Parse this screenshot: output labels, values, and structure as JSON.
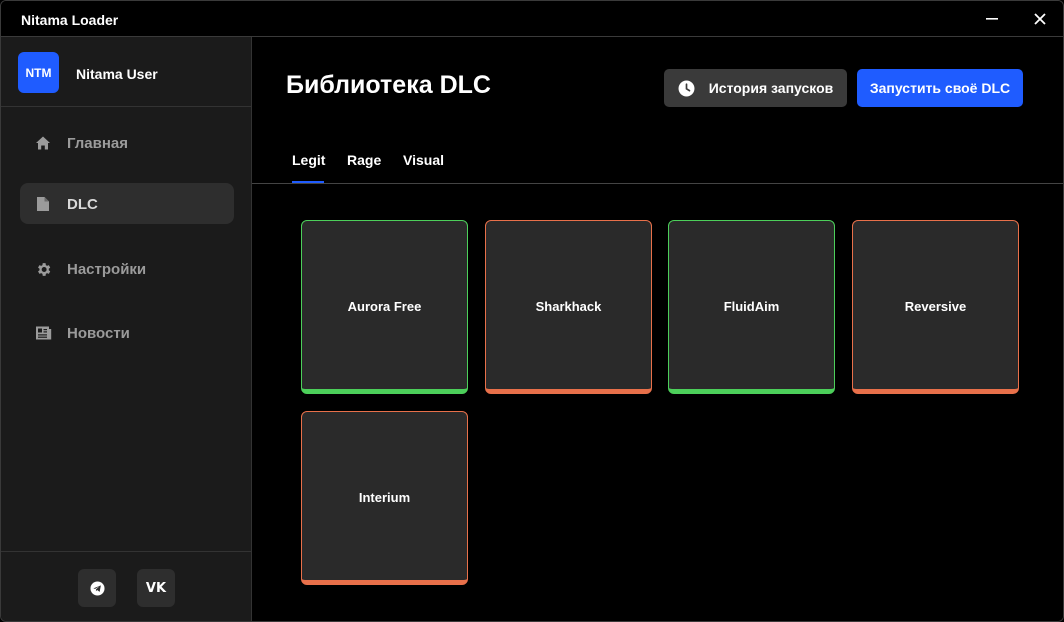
{
  "window": {
    "title": "Nitama Loader"
  },
  "profile": {
    "avatar_text": "NTM",
    "username": "Nitama User"
  },
  "sidebar": {
    "items": [
      {
        "label": "Главная",
        "icon": "home-icon"
      },
      {
        "label": "DLC",
        "icon": "file-icon",
        "active": true
      },
      {
        "label": "Настройки",
        "icon": "gear-icon"
      },
      {
        "label": "Новости",
        "icon": "newspaper-icon"
      }
    ],
    "social": [
      {
        "icon": "telegram-icon"
      },
      {
        "icon": "vk-icon",
        "text": "VK"
      }
    ]
  },
  "main": {
    "title": "Библиотека DLC",
    "history_button": "История запусков",
    "launch_button": "Запустить своё DLC",
    "tabs": [
      {
        "label": "Legit",
        "active": true
      },
      {
        "label": "Rage"
      },
      {
        "label": "Visual"
      }
    ],
    "cards": [
      {
        "name": "Aurora Free",
        "status": "green"
      },
      {
        "name": "Sharkhack",
        "status": "orange"
      },
      {
        "name": "FluidAim",
        "status": "green"
      },
      {
        "name": "Reversive",
        "status": "orange"
      },
      {
        "name": "Interium",
        "status": "orange"
      }
    ]
  },
  "colors": {
    "accent": "#1f5cff",
    "status_green": "#4ccf5a",
    "status_orange": "#e8704a",
    "sidebar_bg": "#1b1b1b",
    "card_bg": "#2a2a2a"
  }
}
